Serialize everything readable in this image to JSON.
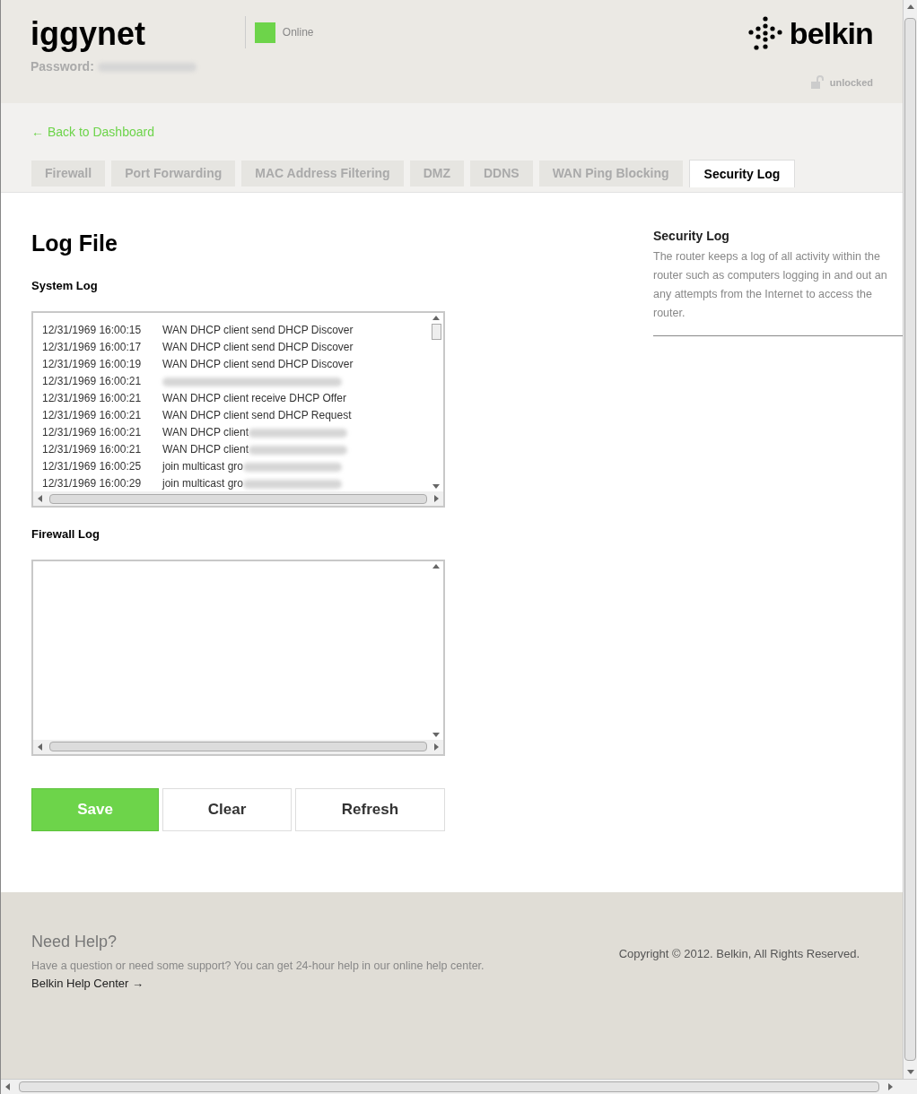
{
  "header": {
    "network_name": "iggynet",
    "password_label": "Password:",
    "status": {
      "label": "Online",
      "color": "#6dd44a"
    },
    "brand": "belkin",
    "lock_status": "unlocked"
  },
  "back_link": "← Back to Dashboard",
  "tabs": [
    {
      "label": "Firewall",
      "selected": false
    },
    {
      "label": "Port Forwarding",
      "selected": false
    },
    {
      "label": "MAC Address Filtering",
      "selected": false
    },
    {
      "label": "DMZ",
      "selected": false
    },
    {
      "label": "DDNS",
      "selected": false
    },
    {
      "label": "WAN Ping Blocking",
      "selected": false
    },
    {
      "label": "Security Log",
      "selected": true
    }
  ],
  "page_title": "Log File",
  "system_log": {
    "label": "System Log",
    "rows": [
      {
        "time": "12/31/1969 16:00:15",
        "message": "WAN DHCP client send DHCP Discover"
      },
      {
        "time": "12/31/1969 16:00:17",
        "message": "WAN DHCP client send DHCP Discover"
      },
      {
        "time": "12/31/1969 16:00:19",
        "message": "WAN DHCP client send DHCP Discover"
      },
      {
        "time": "12/31/1969 16:00:21",
        "redacted": true
      },
      {
        "time": "12/31/1969 16:00:21",
        "message": "WAN DHCP client receive DHCP Offer"
      },
      {
        "time": "12/31/1969 16:00:21",
        "message": "WAN DHCP client send DHCP Request"
      },
      {
        "time": "12/31/1969 16:00:21",
        "message": "WAN DHCP client",
        "redacted": true
      },
      {
        "time": "12/31/1969 16:00:21",
        "message": "WAN DHCP client",
        "redacted": true
      },
      {
        "time": "12/31/1969 16:00:25",
        "message": "join multicast gro",
        "redacted": true
      },
      {
        "time": "12/31/1969 16:00:29",
        "message": "join multicast gro",
        "redacted": true
      }
    ]
  },
  "firewall_log": {
    "label": "Firewall Log"
  },
  "buttons": [
    {
      "label": "Save",
      "kind": "primary"
    },
    {
      "label": "Clear",
      "kind": "secondary"
    },
    {
      "label": "Refresh",
      "kind": "secondary"
    }
  ],
  "help_panel": {
    "title": "Security Log",
    "text": "The router keeps a log of all activity within the\nrouter such as computers logging in and out an\nany attempts from the Internet to access the\nrouter."
  },
  "footer": {
    "title": "Need Help?",
    "text": "Have a question or need some support? You can get 24-hour help in our online help center.",
    "link": "Belkin Help Center →",
    "copyright": "Copyright © 2012. Belkin, All Rights Reserved."
  }
}
